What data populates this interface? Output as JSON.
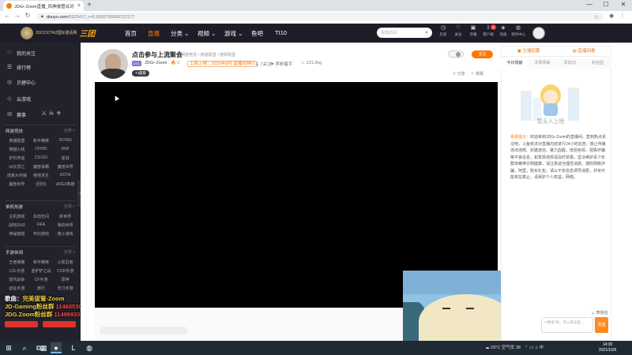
{
  "browser": {
    "tab_title": "JDG• Zoom直播_风神拔管派对",
    "tab_close": "×",
    "new_tab": "+",
    "minimize": "—",
    "maximize": "☐",
    "close": "✕",
    "url_host": "douyu.com",
    "url_path": "/5925417_r=0.5556795806722177",
    "url_full": "douyu.com/5925417_r=0.5556795806722177"
  },
  "header": {
    "logo_text": "2021DOTA2国际邀请赛",
    "logo_brand": "三团",
    "nav": [
      "首页",
      "直播",
      "分类",
      "视频",
      "游戏",
      "鱼吧",
      "TI10"
    ],
    "nav_active_index": 1,
    "search_placeholder": "永劫无间",
    "icons": [
      {
        "name": "history",
        "label": "历史"
      },
      {
        "name": "follow",
        "label": "关注"
      },
      {
        "name": "live",
        "label": "开播"
      },
      {
        "name": "client",
        "label": "客户端"
      },
      {
        "name": "recharge",
        "label": "充值"
      },
      {
        "name": "upload",
        "label": "领作中心"
      }
    ],
    "badge_count": "8"
  },
  "sidebar": {
    "main_items": [
      {
        "icon": "♡",
        "label": "我的关注"
      },
      {
        "icon": "☰",
        "label": "排行榜"
      },
      {
        "icon": "◎",
        "label": "贝碧中心"
      },
      {
        "icon": "◇",
        "label": "云游戏"
      },
      {
        "icon": "✉",
        "label": "赛事"
      }
    ],
    "sections": [
      {
        "title": "网游竞技",
        "more": "全部 >",
        "items": [
          "英雄联盟",
          "和平精英",
          "DOTA2",
          "穿越火线",
          "CF/HD",
          "DNF",
          "炉石传说",
          "CS:GO",
          "逆战",
          "lol云顶之",
          "魔兽争霸",
          "魔兽世界",
          "逃离大乔娘",
          "绝地求生",
          "DOTA",
          "魔兽世界",
          "(回归)",
          "APEX英雄"
        ]
      },
      {
        "title": "单机热游",
        "more": "全部 >",
        "items": [
          "主机游戏",
          "永劫无间",
          "新世界",
          "战地2042",
          "FIFA",
          "我的世界",
          "神秘狼猎",
          "怀旧游戏",
          "格斗游戏"
        ]
      },
      {
        "title": "手游休闲",
        "more": "全部 >",
        "items": [
          "王者荣耀",
          "和平精英",
          "火影忍者",
          "LOL手游",
          "金铲铲之战",
          "COD手游",
          "现代战争",
          "CF手游",
          "原神",
          "远征手游",
          "旅行",
          "天刀手游"
        ]
      }
    ],
    "overlay_lines": [
      {
        "label": "歌曲：",
        "text": "完美拔管-Zoom"
      },
      {
        "label": "JD-Gaming粉丝群",
        "text": "1146053099"
      },
      {
        "label": "JDG.Zoom粉丝群",
        "text": "1149893382"
      }
    ],
    "collapse_glyph": "‹"
  },
  "room": {
    "title": "点击参与上流聚会",
    "category": "网游竞技 • 英雄联盟 • 德累联盟",
    "level_tag": "LV1",
    "anchor": "JDG• Zoom",
    "hot": "🔥 0",
    "rank": "上周上榜：2020年8月 直播间排行",
    "fans": "7关注",
    "share": "养粉着手",
    "popularity": "131.2kg",
    "chip": "TJ面膜",
    "follow_label": "关注",
    "share_link": "⇪ 分享",
    "report_link": "⚐ 举报",
    "danmaku_placeholder": ""
  },
  "chat": {
    "tabs": [
      {
        "label": "主播招募",
        "orange": true
      },
      {
        "label": "直播回看",
        "orange": true
      }
    ],
    "subtabs": [
      "今日贡献",
      "本周贡献",
      "贵宾(0)",
      "粉丝团"
    ],
    "empty_text": "暂无人上榜",
    "system_label": "系统提示：",
    "system_text": "欢迎来到JDG• Zoom的直播间。直到热点关注吧，斗鱼依法对直播内容进行24小时巡查，禁止传播违法违规、封建迷信、暴力血腥、低俗色情、招嫖诈骗等不良信息，如发现违规请及时举报，坚决维护青少年群体精神文明健康。请注意适当理性消费，谨防网络诈骗，阿里，购买礼包，请以不实信息诱导消费，并有可能将在禁止，请保护个人权益，网络。",
    "input_placeholder": "“#黄金”呢，可以来这里…",
    "send": "发送",
    "emoji_label": "☺ 表情包"
  },
  "taskbar": {
    "start": "⊞",
    "search": "⌕",
    "taskview": "⧉",
    "apps": [
      "▦",
      "●",
      "L",
      "◍"
    ],
    "active_app_index": 1,
    "tray_weather": "☁ 29°C 空气优 38",
    "tray_icons": "⌃ ▭ ♫ 中",
    "time": "14:30",
    "date": "2021/10/9"
  }
}
